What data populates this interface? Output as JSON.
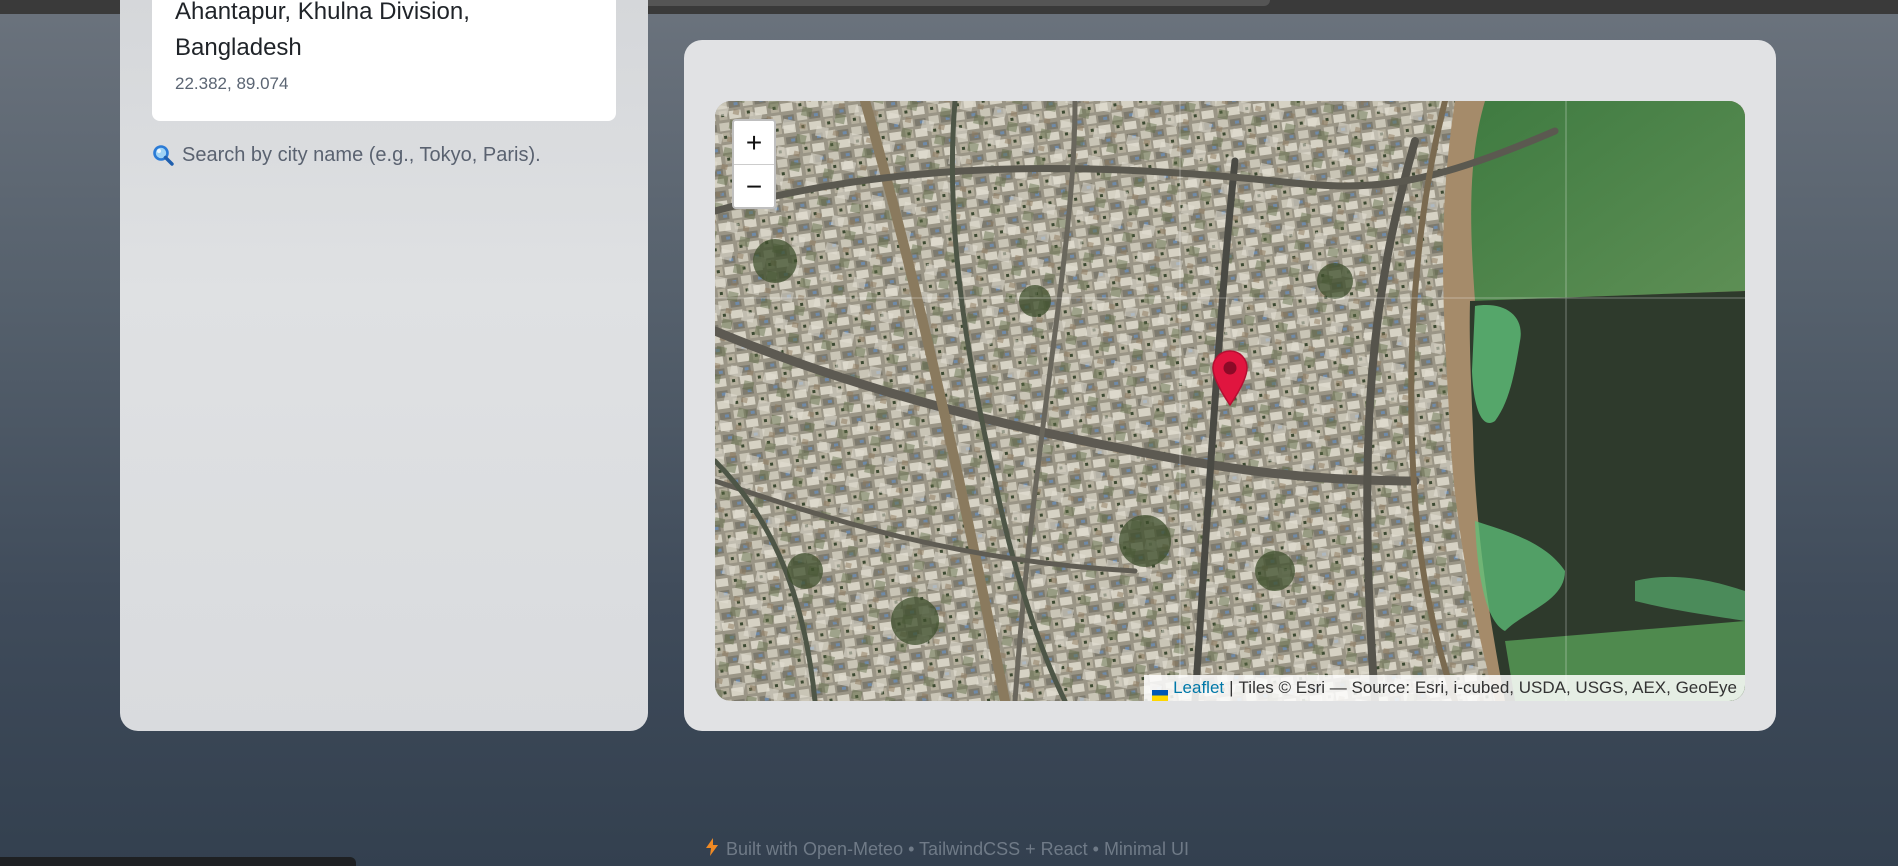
{
  "location": {
    "name": "Ahantapur, Khulna Division, Bangladesh",
    "coords": "22.382, 89.074"
  },
  "search": {
    "icon": "magnifier-icon",
    "placeholder": "Search by city name (e.g., Tokyo, Paris)."
  },
  "map": {
    "zoom_in_label": "+",
    "zoom_out_label": "−",
    "marker_color": "#e0153f",
    "attribution": {
      "link_label": "Leaflet",
      "separator": "|",
      "text": "Tiles © Esri — Source: Esri, i-cubed, USDA, USGS, AEX, GeoEye"
    }
  },
  "footer": {
    "icon": "lightning-icon",
    "text": "Built with Open-Meteo • TailwindCSS + React • Minimal UI"
  },
  "colors": {
    "accent_link": "#0078a8",
    "lightning": "#f08a24"
  }
}
